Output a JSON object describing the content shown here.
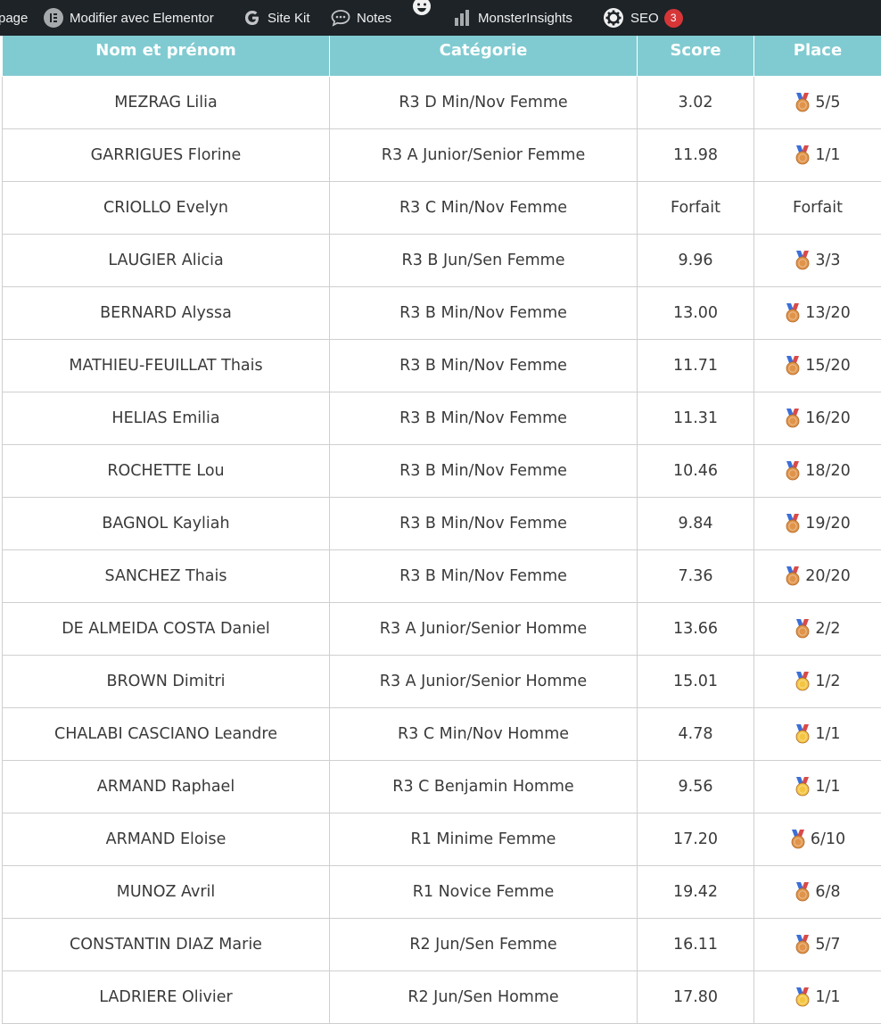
{
  "admin_bar": {
    "page_label": "page",
    "elementor_label": "Modifier avec Elementor",
    "sitekit_label": "Site Kit",
    "notes_label": "Notes",
    "monsterinsights_label": "MonsterInsights",
    "seo_label": "SEO",
    "seo_count": "3"
  },
  "table": {
    "headers": [
      "Nom et prénom",
      "Catégorie",
      "Score",
      "Place"
    ],
    "rows": [
      {
        "name": "MEZRAG Lilia",
        "category": "R3 D Min/Nov Femme",
        "score": "3.02",
        "place": "5/5",
        "medal": "bronze"
      },
      {
        "name": "GARRIGUES Florine",
        "category": "R3 A Junior/Senior Femme",
        "score": "11.98",
        "place": "1/1",
        "medal": "bronze"
      },
      {
        "name": "CRIOLLO Evelyn",
        "category": "R3 C Min/Nov Femme",
        "score": "Forfait",
        "place": "Forfait",
        "medal": ""
      },
      {
        "name": "LAUGIER Alicia",
        "category": "R3 B Jun/Sen Femme",
        "score": "9.96",
        "place": "3/3",
        "medal": "bronze"
      },
      {
        "name": "BERNARD Alyssa",
        "category": "R3 B Min/Nov Femme",
        "score": "13.00",
        "place": "13/20",
        "medal": "bronze"
      },
      {
        "name": "MATHIEU-FEUILLAT Thais",
        "category": "R3 B Min/Nov Femme",
        "score": "11.71",
        "place": "15/20",
        "medal": "bronze"
      },
      {
        "name": "HELIAS Emilia",
        "category": "R3 B Min/Nov Femme",
        "score": "11.31",
        "place": "16/20",
        "medal": "bronze"
      },
      {
        "name": "ROCHETTE Lou",
        "category": "R3 B Min/Nov Femme",
        "score": "10.46",
        "place": "18/20",
        "medal": "bronze"
      },
      {
        "name": "BAGNOL Kayliah",
        "category": "R3 B Min/Nov Femme",
        "score": "9.84",
        "place": "19/20",
        "medal": "bronze"
      },
      {
        "name": "SANCHEZ Thais",
        "category": "R3 B Min/Nov Femme",
        "score": "7.36",
        "place": "20/20",
        "medal": "bronze"
      },
      {
        "name": "DE ALMEIDA COSTA Daniel",
        "category": "R3 A Junior/Senior Homme",
        "score": "13.66",
        "place": "2/2",
        "medal": "bronze"
      },
      {
        "name": "BROWN Dimitri",
        "category": "R3 A Junior/Senior Homme",
        "score": "15.01",
        "place": "1/2",
        "medal": "gold"
      },
      {
        "name": "CHALABI CASCIANO Leandre",
        "category": "R3 C Min/Nov Homme",
        "score": "4.78",
        "place": "1/1",
        "medal": "gold"
      },
      {
        "name": "ARMAND Raphael",
        "category": "R3 C Benjamin Homme",
        "score": "9.56",
        "place": "1/1",
        "medal": "gold"
      },
      {
        "name": "ARMAND Eloise",
        "category": "R1 Minime Femme",
        "score": "17.20",
        "place": "6/10",
        "medal": "bronze"
      },
      {
        "name": "MUNOZ Avril",
        "category": "R1 Novice Femme",
        "score": "19.42",
        "place": "6/8",
        "medal": "bronze"
      },
      {
        "name": "CONSTANTIN DIAZ Marie",
        "category": "R2 Jun/Sen Femme",
        "score": "16.11",
        "place": "5/7",
        "medal": "bronze"
      },
      {
        "name": "LADRIERE Olivier",
        "category": "R2 Jun/Sen Homme",
        "score": "17.80",
        "place": "1/1",
        "medal": "gold"
      }
    ]
  },
  "colors": {
    "header_bg": "#80cbd1",
    "admin_bar_bg": "#1d2327",
    "badge_red": "#d63638",
    "medal_gold": "#f4c542",
    "medal_bronze": "#e0944a"
  },
  "icons": {
    "elementor": "elementor-icon",
    "sitekit": "google-g-icon",
    "notes": "speech-bubble-icon",
    "emoji": "smiley-icon",
    "monsterinsights": "bar-chart-icon",
    "seo": "gear-icon",
    "medal": "medal-icon"
  }
}
